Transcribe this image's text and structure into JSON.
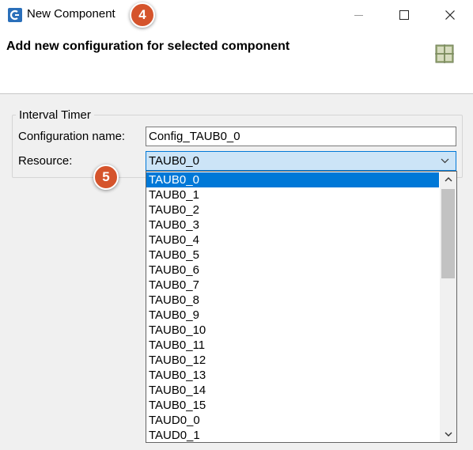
{
  "window": {
    "title": "New Component"
  },
  "header": {
    "title": "Add new configuration for selected component"
  },
  "group": {
    "title": "Interval Timer",
    "config_name_label": "Configuration name:",
    "config_name_value": "Config_TAUB0_0",
    "resource_label": "Resource:",
    "resource_value": "TAUB0_0"
  },
  "dropdown": {
    "options": [
      "TAUB0_0",
      "TAUB0_1",
      "TAUB0_2",
      "TAUB0_3",
      "TAUB0_4",
      "TAUB0_5",
      "TAUB0_6",
      "TAUB0_7",
      "TAUB0_8",
      "TAUB0_9",
      "TAUB0_10",
      "TAUB0_11",
      "TAUB0_12",
      "TAUB0_13",
      "TAUB0_14",
      "TAUB0_15",
      "TAUD0_0",
      "TAUD0_1"
    ],
    "selected_index": 0
  },
  "badges": {
    "step4": "4",
    "step5": "5"
  },
  "colors": {
    "accent": "#0078d7",
    "badge": "#d5542c",
    "combo_bg": "#cce4f7"
  },
  "icons": {
    "app": "renesas-smart-configurator-icon",
    "header": "component-grid-icon",
    "minimize": "minimize-icon",
    "maximize": "maximize-icon",
    "close": "close-icon",
    "combo": "chevron-down-icon",
    "scroll_up": "chevron-up-icon",
    "scroll_down": "chevron-down-icon"
  }
}
